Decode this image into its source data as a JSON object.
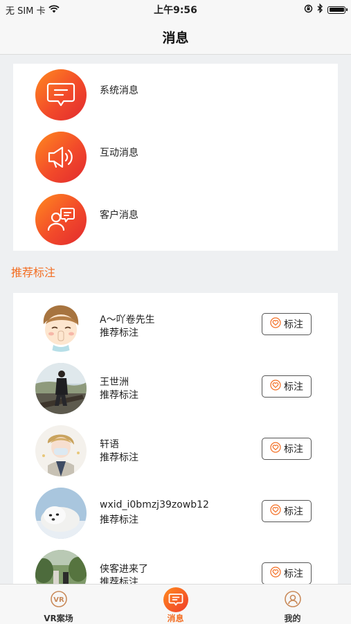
{
  "status": {
    "carrier": "无 SIM 卡",
    "time": "上午9:56"
  },
  "header": {
    "title": "消息"
  },
  "messages": [
    {
      "label": "系统消息",
      "icon": "system-message-icon"
    },
    {
      "label": "互动消息",
      "icon": "megaphone-icon"
    },
    {
      "label": "客户消息",
      "icon": "customer-message-icon"
    }
  ],
  "recommend": {
    "title": "推荐标注",
    "items": [
      {
        "name": "A～吖卷先生",
        "subtitle": "推荐标注",
        "button": "标注"
      },
      {
        "name": "王世洲",
        "subtitle": "推荐标注",
        "button": "标注"
      },
      {
        "name": "轩语",
        "subtitle": "推荐标注",
        "button": "标注"
      },
      {
        "name": "wxid_i0bmzj39zowb12",
        "subtitle": "推荐标注",
        "button": "标注"
      },
      {
        "name": "侠客进来了",
        "subtitle": "推荐标注",
        "button": "标注"
      }
    ]
  },
  "tabs": [
    {
      "label": "VR案场",
      "icon": "vr-icon",
      "active": false
    },
    {
      "label": "消息",
      "icon": "message-icon",
      "active": true
    },
    {
      "label": "我的",
      "icon": "profile-icon",
      "active": false
    }
  ],
  "colors": {
    "accent": "#f36d21",
    "gradient_start": "#ff8a1f",
    "gradient_end": "#e12a2f"
  }
}
